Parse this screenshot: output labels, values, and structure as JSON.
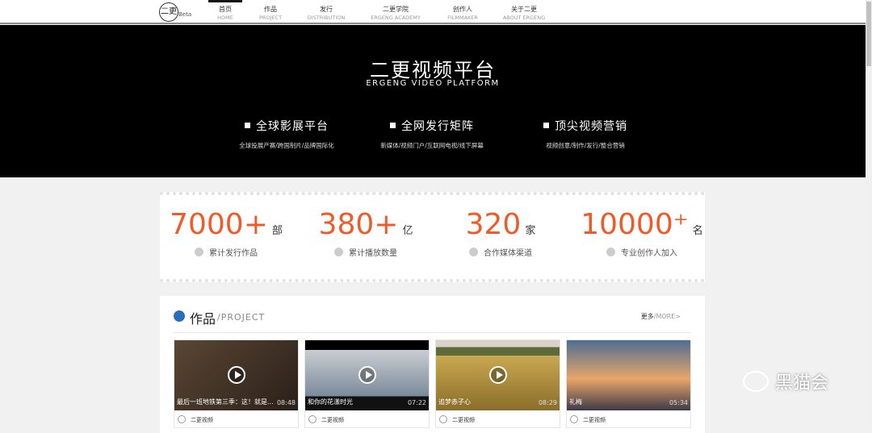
{
  "nav": {
    "logo": "二更",
    "beta": "Beta",
    "items": [
      {
        "zh": "首页",
        "en": "HOME"
      },
      {
        "zh": "作品",
        "en": "PROJECT"
      },
      {
        "zh": "发行",
        "en": "DISTRIBUTION"
      },
      {
        "zh": "二更学院",
        "en": "ERGENG ACADEMY"
      },
      {
        "zh": "创作人",
        "en": "FILMMAKER"
      },
      {
        "zh": "关于二更",
        "en": "ABOUT ERGENG"
      }
    ]
  },
  "hero": {
    "title": "二更视频平台",
    "subtitle": "ERGENG VIDEO PLATFORM",
    "features": [
      {
        "title": "全球影展平台",
        "desc": "全球投展产赛/跨国制片/品牌国际化"
      },
      {
        "title": "全网发行矩阵",
        "desc": "新媒体/视频门户/互联网电视/线下屏幕"
      },
      {
        "title": "顶尖视频营销",
        "desc": "视频创意/制作/发行/整合营销"
      }
    ]
  },
  "stats": [
    {
      "num": "7000+",
      "unit": "部",
      "label": "累计发行作品"
    },
    {
      "num": "380+",
      "unit": "亿",
      "label": "累计播放数量"
    },
    {
      "num": "320",
      "unit": "家",
      "label": "合作媒体渠道"
    },
    {
      "num": "10000⁺",
      "unit": "名",
      "label": "专业创作人加入"
    }
  ],
  "project": {
    "title": "作品",
    "en": "/PROJECT",
    "more_zh": "更多",
    "more_en": "/MORE>",
    "cards": [
      {
        "title": "最后一班地铁第三季：这！就是...",
        "duration": "08:48",
        "author": "二更视频",
        "bg": "#4a3a2c"
      },
      {
        "title": "和你的花漾时光",
        "duration": "07:22",
        "author": "二更视频",
        "bg": "#8a8f98"
      },
      {
        "title": "追梦赤子心",
        "duration": "08:29",
        "author": "二更视频",
        "bg": "#b59a4e"
      },
      {
        "title": "礼梅",
        "duration": "05:34",
        "author": "二更视频",
        "bg": "#6b5a6a"
      }
    ]
  },
  "watermark": "黑猫会"
}
